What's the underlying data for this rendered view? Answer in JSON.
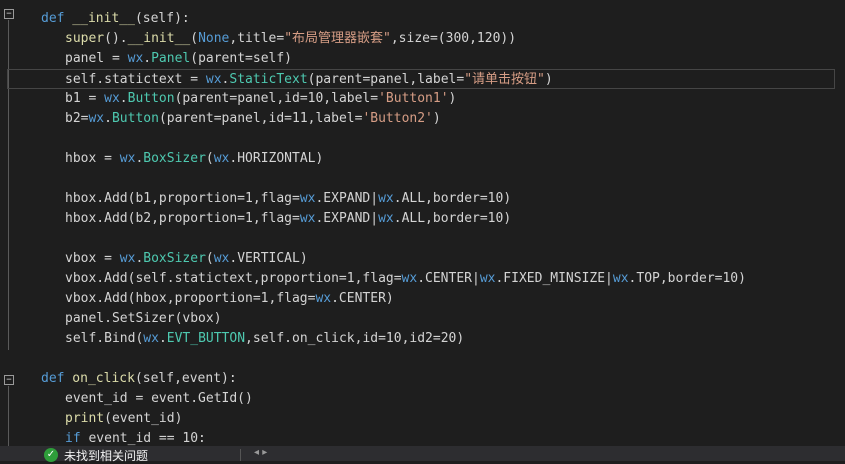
{
  "editor": {
    "lines": [
      {
        "indent": "   ",
        "tokens": [
          [
            "def",
            "kw"
          ],
          [
            " __init__",
            "fn"
          ],
          [
            "(self):",
            "id"
          ]
        ]
      },
      {
        "indent": "      ",
        "tokens": [
          [
            "super",
            "fn"
          ],
          [
            "().",
            "id"
          ],
          [
            "__init__",
            "fn"
          ],
          [
            "(",
            "id"
          ],
          [
            "None",
            "kw"
          ],
          [
            ",title=",
            "id"
          ],
          [
            "\"布局管理器嵌套\"",
            "str"
          ],
          [
            ",size=(300,120))",
            "id"
          ]
        ]
      },
      {
        "indent": "      ",
        "tokens": [
          [
            "panel = ",
            "id"
          ],
          [
            "wx",
            "kw"
          ],
          [
            ".",
            "id"
          ],
          [
            "Panel",
            "cls"
          ],
          [
            "(parent=self)",
            "id"
          ]
        ]
      },
      {
        "indent": "      ",
        "tokens": [
          [
            "self.statictext = ",
            "id"
          ],
          [
            "wx",
            "kw"
          ],
          [
            ".",
            "id"
          ],
          [
            "StaticText",
            "cls"
          ],
          [
            "(parent=panel,label=",
            "id"
          ],
          [
            "\"请单击按钮\"",
            "str"
          ],
          [
            ")",
            "id"
          ]
        ],
        "current": true
      },
      {
        "indent": "      ",
        "tokens": [
          [
            "b1 = ",
            "id"
          ],
          [
            "wx",
            "kw"
          ],
          [
            ".",
            "id"
          ],
          [
            "Button",
            "cls"
          ],
          [
            "(parent=panel,id=10,label=",
            "id"
          ],
          [
            "'Button1'",
            "str"
          ],
          [
            ")",
            "id"
          ]
        ]
      },
      {
        "indent": "      ",
        "tokens": [
          [
            "b2=",
            "id"
          ],
          [
            "wx",
            "kw"
          ],
          [
            ".",
            "id"
          ],
          [
            "Button",
            "cls"
          ],
          [
            "(parent=panel,id=11,label=",
            "id"
          ],
          [
            "'Button2'",
            "str"
          ],
          [
            ")",
            "id"
          ]
        ]
      },
      {
        "indent": "",
        "tokens": []
      },
      {
        "indent": "      ",
        "tokens": [
          [
            "hbox = ",
            "id"
          ],
          [
            "wx",
            "kw"
          ],
          [
            ".",
            "id"
          ],
          [
            "BoxSizer",
            "cls"
          ],
          [
            "(",
            "id"
          ],
          [
            "wx",
            "kw"
          ],
          [
            ".HORIZONTAL)",
            "id"
          ]
        ]
      },
      {
        "indent": "",
        "tokens": []
      },
      {
        "indent": "      ",
        "tokens": [
          [
            "hbox.Add(b1,proportion=1,flag=",
            "id"
          ],
          [
            "wx",
            "kw"
          ],
          [
            ".EXPAND|",
            "id"
          ],
          [
            "wx",
            "kw"
          ],
          [
            ".ALL,border=10)",
            "id"
          ]
        ]
      },
      {
        "indent": "      ",
        "tokens": [
          [
            "hbox.Add(b2,proportion=1,flag=",
            "id"
          ],
          [
            "wx",
            "kw"
          ],
          [
            ".EXPAND|",
            "id"
          ],
          [
            "wx",
            "kw"
          ],
          [
            ".ALL,border=10)",
            "id"
          ]
        ]
      },
      {
        "indent": "",
        "tokens": []
      },
      {
        "indent": "      ",
        "tokens": [
          [
            "vbox = ",
            "id"
          ],
          [
            "wx",
            "kw"
          ],
          [
            ".",
            "id"
          ],
          [
            "BoxSizer",
            "cls"
          ],
          [
            "(",
            "id"
          ],
          [
            "wx",
            "kw"
          ],
          [
            ".VERTICAL)",
            "id"
          ]
        ]
      },
      {
        "indent": "      ",
        "tokens": [
          [
            "vbox.Add(self.statictext,proportion=1,flag=",
            "id"
          ],
          [
            "wx",
            "kw"
          ],
          [
            ".CENTER|",
            "id"
          ],
          [
            "wx",
            "kw"
          ],
          [
            ".FIXED_MINSIZE|",
            "id"
          ],
          [
            "wx",
            "kw"
          ],
          [
            ".TOP,border=10)",
            "id"
          ]
        ]
      },
      {
        "indent": "      ",
        "tokens": [
          [
            "vbox.Add(hbox,proportion=1,flag=",
            "id"
          ],
          [
            "wx",
            "kw"
          ],
          [
            ".CENTER)",
            "id"
          ]
        ]
      },
      {
        "indent": "      ",
        "tokens": [
          [
            "panel.SetSizer(vbox)",
            "id"
          ]
        ]
      },
      {
        "indent": "      ",
        "tokens": [
          [
            "self.Bind(",
            "id"
          ],
          [
            "wx",
            "kw"
          ],
          [
            ".",
            "id"
          ],
          [
            "EVT_BUTTON",
            "cls"
          ],
          [
            ",self.on_click,id=10,id2=20)",
            "id"
          ]
        ]
      },
      {
        "indent": "",
        "tokens": []
      },
      {
        "indent": "   ",
        "tokens": [
          [
            "def",
            "kw"
          ],
          [
            " on_click",
            "fn"
          ],
          [
            "(self,event):",
            "id"
          ]
        ]
      },
      {
        "indent": "      ",
        "tokens": [
          [
            "event_id = event.GetId()",
            "id"
          ]
        ]
      },
      {
        "indent": "      ",
        "tokens": [
          [
            "print",
            "fn"
          ],
          [
            "(event_id)",
            "id"
          ]
        ]
      },
      {
        "indent": "      ",
        "tokens": [
          [
            "if",
            "kw"
          ],
          [
            " event_id == 10:",
            "id"
          ]
        ]
      }
    ]
  },
  "status_bar": {
    "message": "未找到相关问题",
    "icon": "check-circle-icon"
  },
  "colors": {
    "background": "#1e1e1e",
    "keyword": "#569cd6",
    "class": "#4ec9b0",
    "string": "#d69d85",
    "identifier": "#d4d4d4",
    "status_ok": "#2e9e3a"
  }
}
